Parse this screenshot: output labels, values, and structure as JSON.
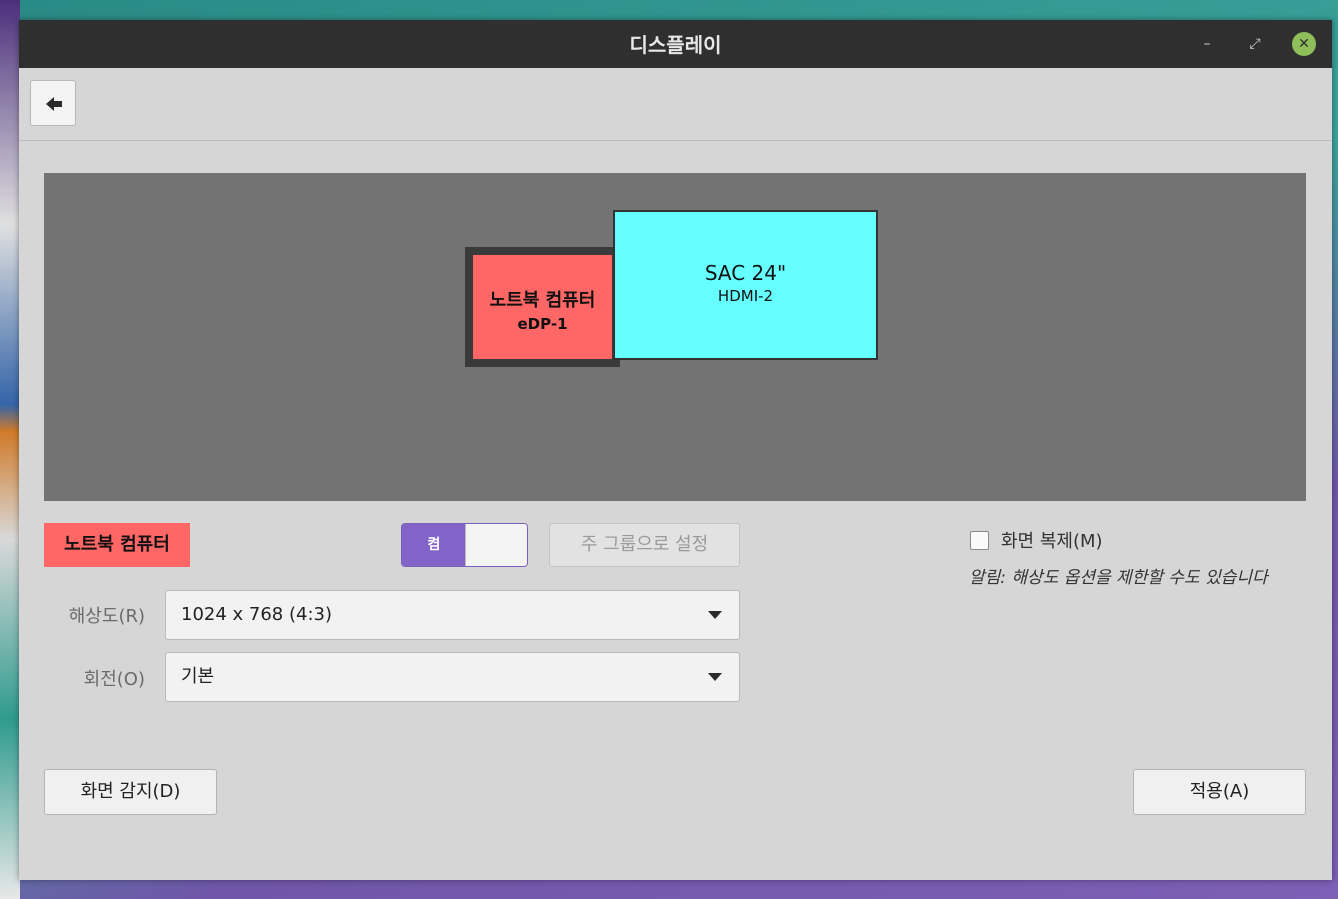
{
  "window": {
    "title": "디스플레이",
    "minimize_glyph": "–",
    "maximize_glyph": "⤢",
    "close_glyph": "✕"
  },
  "toolbar": {
    "back_icon": "back-arrow-icon"
  },
  "preview": {
    "monitors": [
      {
        "name": "노트북 컴퓨터",
        "port": "eDP-1",
        "color": "#ff6666"
      },
      {
        "name": "SAC 24\"",
        "port": "HDMI-2",
        "color": "#66ffff"
      }
    ]
  },
  "settings": {
    "selected_monitor": "노트북 컴퓨터",
    "toggle_label": "켬",
    "toggle_state": "on",
    "primary_button": "주 그룹으로 설정",
    "resolution_label": "해상도(R)",
    "resolution_value": "1024 x 768 (4:3)",
    "rotation_label": "회전(O)",
    "rotation_value": "기본",
    "mirror_label": "화면 복제(M)",
    "mirror_checked": false,
    "mirror_note": "알림: 해상도 옵션을 제한할 수도 있습니다"
  },
  "buttons": {
    "detect": "화면 감지(D)",
    "apply": "적용(A)"
  },
  "colors": {
    "titlebar": "#2f2f2f",
    "accent": "#8264c8",
    "close_button": "#8fbf5a"
  }
}
